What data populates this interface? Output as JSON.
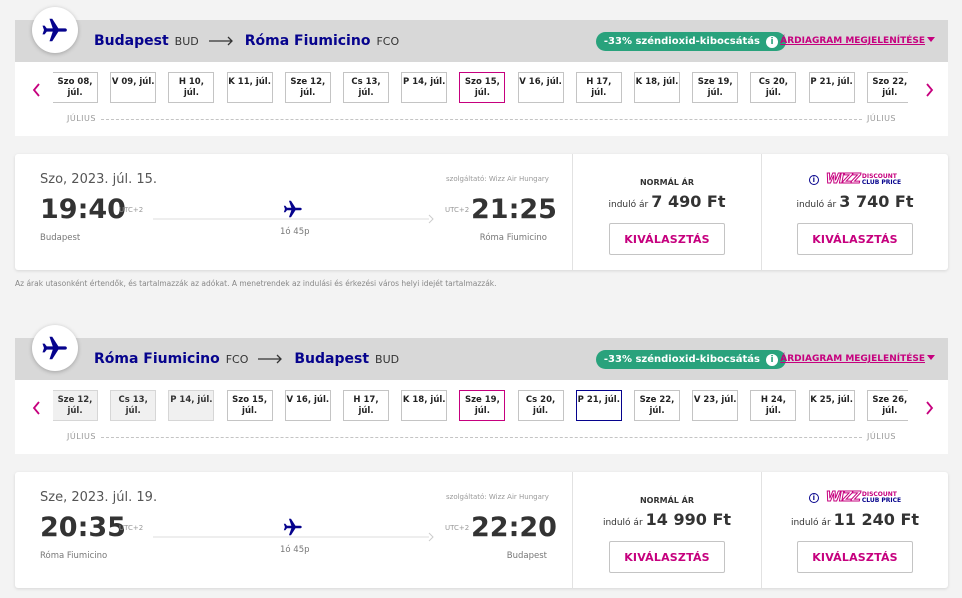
{
  "outbound": {
    "origin": "Budapest",
    "origin_code": "BUD",
    "dest": "Róma Fiumicino",
    "dest_code": "FCO",
    "co2": "-33% széndioxid-kibocsátás",
    "chart_link": "ÁRDIAGRAM MEGJELENÍTÉSE",
    "month_left": "JÚLIUS",
    "month_right": "JÚLIUS",
    "dates": [
      {
        "l1": "Szo 08,",
        "l2": "júl.",
        "state": "normal"
      },
      {
        "l1": "V 09, júl.",
        "l2": "",
        "state": "normal"
      },
      {
        "l1": "H 10,",
        "l2": "júl.",
        "state": "normal"
      },
      {
        "l1": "K 11, júl.",
        "l2": "",
        "state": "normal"
      },
      {
        "l1": "Sze 12,",
        "l2": "júl.",
        "state": "normal"
      },
      {
        "l1": "Cs 13,",
        "l2": "júl.",
        "state": "normal"
      },
      {
        "l1": "P 14, júl.",
        "l2": "",
        "state": "normal"
      },
      {
        "l1": "Szo 15,",
        "l2": "júl.",
        "state": "selected"
      },
      {
        "l1": "V 16, júl.",
        "l2": "",
        "state": "normal"
      },
      {
        "l1": "H 17,",
        "l2": "júl.",
        "state": "normal"
      },
      {
        "l1": "K 18, júl.",
        "l2": "",
        "state": "normal"
      },
      {
        "l1": "Sze 19,",
        "l2": "júl.",
        "state": "normal"
      },
      {
        "l1": "Cs 20,",
        "l2": "júl.",
        "state": "normal"
      },
      {
        "l1": "P 21, júl.",
        "l2": "",
        "state": "normal"
      },
      {
        "l1": "Szo 22,",
        "l2": "júl.",
        "state": "normal"
      }
    ],
    "flight": {
      "date": "Szo, 2023. júl. 15.",
      "operator": "szolgáltató: Wizz Air Hungary",
      "dep_time": "19:40",
      "arr_time": "21:25",
      "utc_dep": "UTC+2",
      "utc_arr": "UTC+2",
      "duration": "1ó 45p",
      "dep_city": "Budapest",
      "arr_city": "Róma Fiumicino"
    },
    "fares": {
      "normal_label": "NORMÁL ÁR",
      "from_label": "induló ár",
      "normal_price": "7 490 Ft",
      "club_price": "3 740 Ft",
      "select": "KIVÁLASZTÁS"
    }
  },
  "note": "Az árak utasonként értendők, és tartalmazzák az adókat. A menetrendek az indulási és érkezési város helyi idejét tartalmazzák.",
  "inbound": {
    "origin": "Róma Fiumicino",
    "origin_code": "FCO",
    "dest": "Budapest",
    "dest_code": "BUD",
    "co2": "-33% széndioxid-kibocsátás",
    "chart_link": "ÁRDIAGRAM MEGJELENÍTÉSE",
    "month_left": "JÚLIUS",
    "month_right": "JÚLIUS",
    "dates": [
      {
        "l1": "Sze 12,",
        "l2": "júl.",
        "state": "disabled"
      },
      {
        "l1": "Cs 13,",
        "l2": "júl.",
        "state": "disabled"
      },
      {
        "l1": "P 14, júl.",
        "l2": "",
        "state": "disabled"
      },
      {
        "l1": "Szo 15,",
        "l2": "júl.",
        "state": "normal"
      },
      {
        "l1": "V 16, júl.",
        "l2": "",
        "state": "normal"
      },
      {
        "l1": "H 17,",
        "l2": "júl.",
        "state": "normal"
      },
      {
        "l1": "K 18, júl.",
        "l2": "",
        "state": "normal"
      },
      {
        "l1": "Sze 19,",
        "l2": "júl.",
        "state": "selected"
      },
      {
        "l1": "Cs 20,",
        "l2": "júl.",
        "state": "normal"
      },
      {
        "l1": "P 21, júl.",
        "l2": "",
        "state": "return"
      },
      {
        "l1": "Sze 22,",
        "l2": "júl.",
        "state": "normal"
      },
      {
        "l1": "V 23, júl.",
        "l2": "",
        "state": "normal"
      },
      {
        "l1": "H 24,",
        "l2": "júl.",
        "state": "normal"
      },
      {
        "l1": "K 25, júl.",
        "l2": "",
        "state": "normal"
      },
      {
        "l1": "Sze 26,",
        "l2": "júl.",
        "state": "normal"
      }
    ],
    "flight": {
      "date": "Sze, 2023. júl. 19.",
      "operator": "szolgáltató: Wizz Air Hungary",
      "dep_time": "20:35",
      "arr_time": "22:20",
      "utc_dep": "UTC+2",
      "utc_arr": "UTC+2",
      "duration": "1ó 45p",
      "dep_city": "Róma Fiumicino",
      "arr_city": "Budapest"
    },
    "fares": {
      "normal_label": "NORMÁL ÁR",
      "from_label": "induló ár",
      "normal_price": "14 990 Ft",
      "club_price": "11 240 Ft",
      "select": "KIVÁLASZTÁS"
    }
  },
  "club": {
    "logo_word": "WIZZ",
    "line1": "DISCOUNT",
    "line2": "CLUB PRICE"
  },
  "colors": {
    "brand_navy": "#06038d",
    "brand_magenta": "#c6007e",
    "co2_green": "#29a27c"
  }
}
